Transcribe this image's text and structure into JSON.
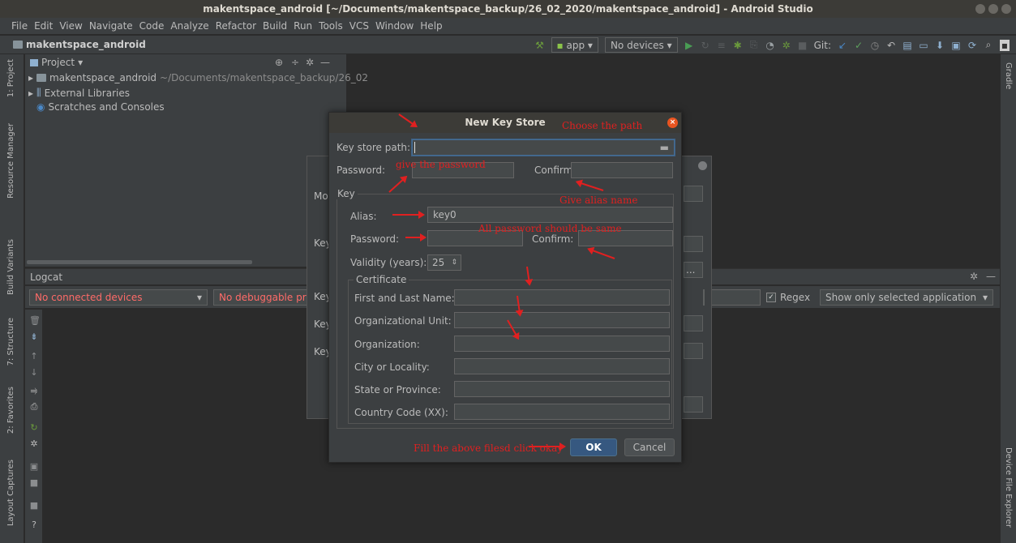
{
  "window": {
    "title": "makentspace_android [~/Documents/makentspace_backup/26_02_2020/makentspace_android] - Android Studio"
  },
  "menu": [
    "File",
    "Edit",
    "View",
    "Navigate",
    "Code",
    "Analyze",
    "Refactor",
    "Build",
    "Run",
    "Tools",
    "VCS",
    "Window",
    "Help"
  ],
  "navbar": {
    "project": "makentspace_android",
    "run_config": "app",
    "device": "No devices",
    "git_label": "Git:"
  },
  "left_tabs": {
    "project": "1: Project",
    "resource_manager": "Resource Manager",
    "build_variants": "Build Variants",
    "structure": "7: Structure",
    "favorites": "2: Favorites",
    "layout_captures": "Layout Captures"
  },
  "right_tabs": {
    "gradle": "Gradle",
    "device_file_explorer": "Device File Explorer"
  },
  "project_panel": {
    "view_label": "Project",
    "items": [
      {
        "name": "makentspace_android",
        "path": "~/Documents/makentspace_backup/26_02"
      },
      {
        "name": "External Libraries",
        "path": ""
      },
      {
        "name": "Scratches and Consoles",
        "path": ""
      }
    ]
  },
  "logcat": {
    "title": "Logcat",
    "device_select": "No connected devices",
    "process_select": "No debuggable proc",
    "regex_label": "Regex",
    "filter_select": "Show only selected application"
  },
  "bg_dialog": {
    "labels": [
      "Mo",
      "Key",
      "Key",
      "Key",
      "Key"
    ],
    "browse_label": "..."
  },
  "dialog": {
    "title": "New Key Store",
    "keystore_path_label": "Key store path:",
    "keystore_path_value": "",
    "password_label": "Password:",
    "confirm_label": "Confirm:",
    "key_group_title": "Key",
    "alias_label": "Alias:",
    "alias_value": "key0",
    "key_password_label": "Password:",
    "key_confirm_label": "Confirm:",
    "validity_label": "Validity (years):",
    "validity_value": "25",
    "certificate_title": "Certificate",
    "cert_fields": [
      {
        "label": "First and Last Name:",
        "value": ""
      },
      {
        "label": "Organizational Unit:",
        "value": ""
      },
      {
        "label": "Organization:",
        "value": ""
      },
      {
        "label": "City or Locality:",
        "value": ""
      },
      {
        "label": "State or Province:",
        "value": ""
      },
      {
        "label": "Country Code (XX):",
        "value": ""
      }
    ],
    "ok_label": "OK",
    "cancel_label": "Cancel"
  },
  "annotations": {
    "choose_path": "Choose the path",
    "give_password": "give the password",
    "give_alias": "Give alias name",
    "same_password": "All password should be same",
    "fill_fields": "Fill the above filesd click okay"
  },
  "colors": {
    "annotation": "#e02020",
    "accent": "#365880",
    "close": "#e95420",
    "warning_text": "#ff6b68"
  }
}
